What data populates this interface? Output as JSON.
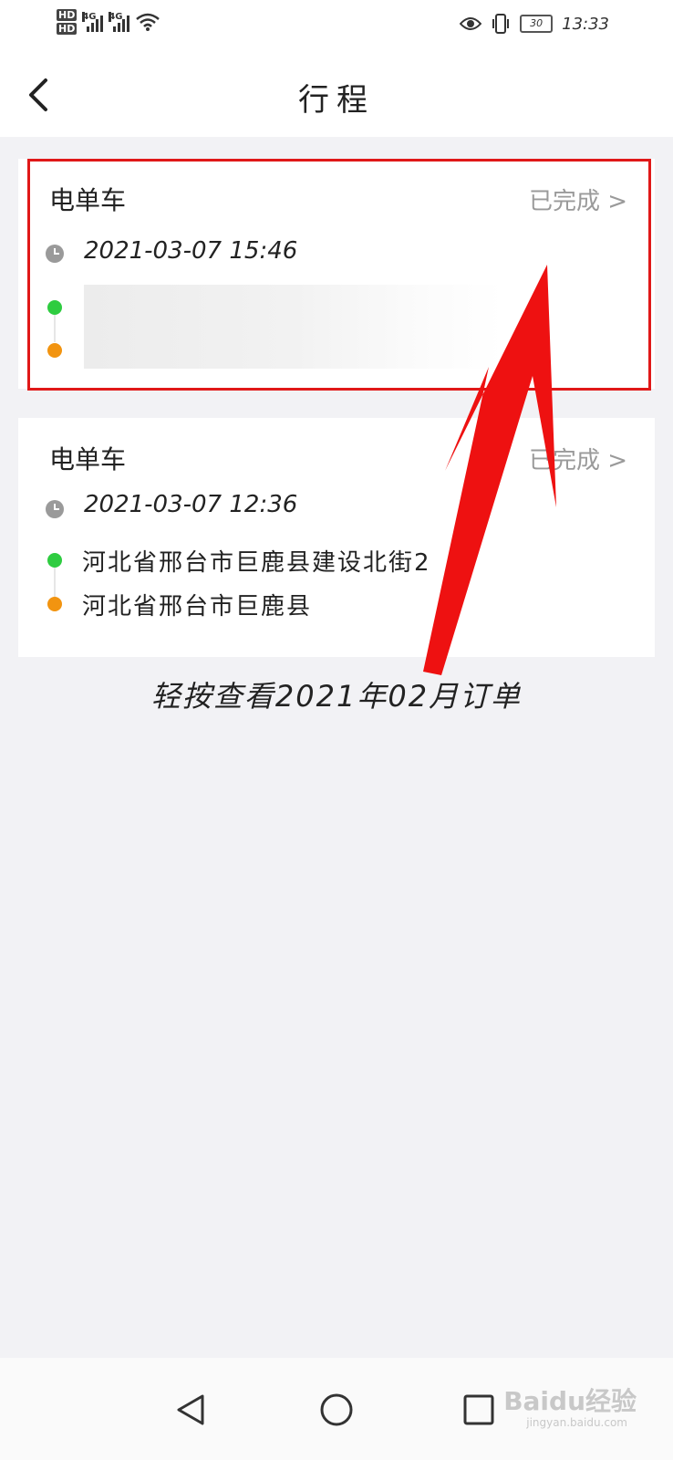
{
  "status_bar": {
    "hd1": "HD",
    "hd2": "HD",
    "net1": "4G",
    "net2": "4G",
    "battery": "30",
    "time": "13:33"
  },
  "header": {
    "title": "行程"
  },
  "trips": [
    {
      "type": "电单车",
      "status": "已完成 >",
      "time": "2021-03-07 15:46",
      "start_address": "",
      "end_address": ""
    },
    {
      "type": "电单车",
      "status": "已完成 >",
      "time": "2021-03-07 12:36",
      "start_address": "河北省邢台市巨鹿县建设北街2",
      "end_address": "河北省邢台市巨鹿县"
    }
  ],
  "annotation": {
    "caption": "轻按查看2021年02月订单",
    "highlight_color": "#e01818",
    "arrow_color": "#ee1111"
  },
  "watermark": {
    "text": "Baidu经验",
    "sub": "jingyan.baidu.com"
  }
}
